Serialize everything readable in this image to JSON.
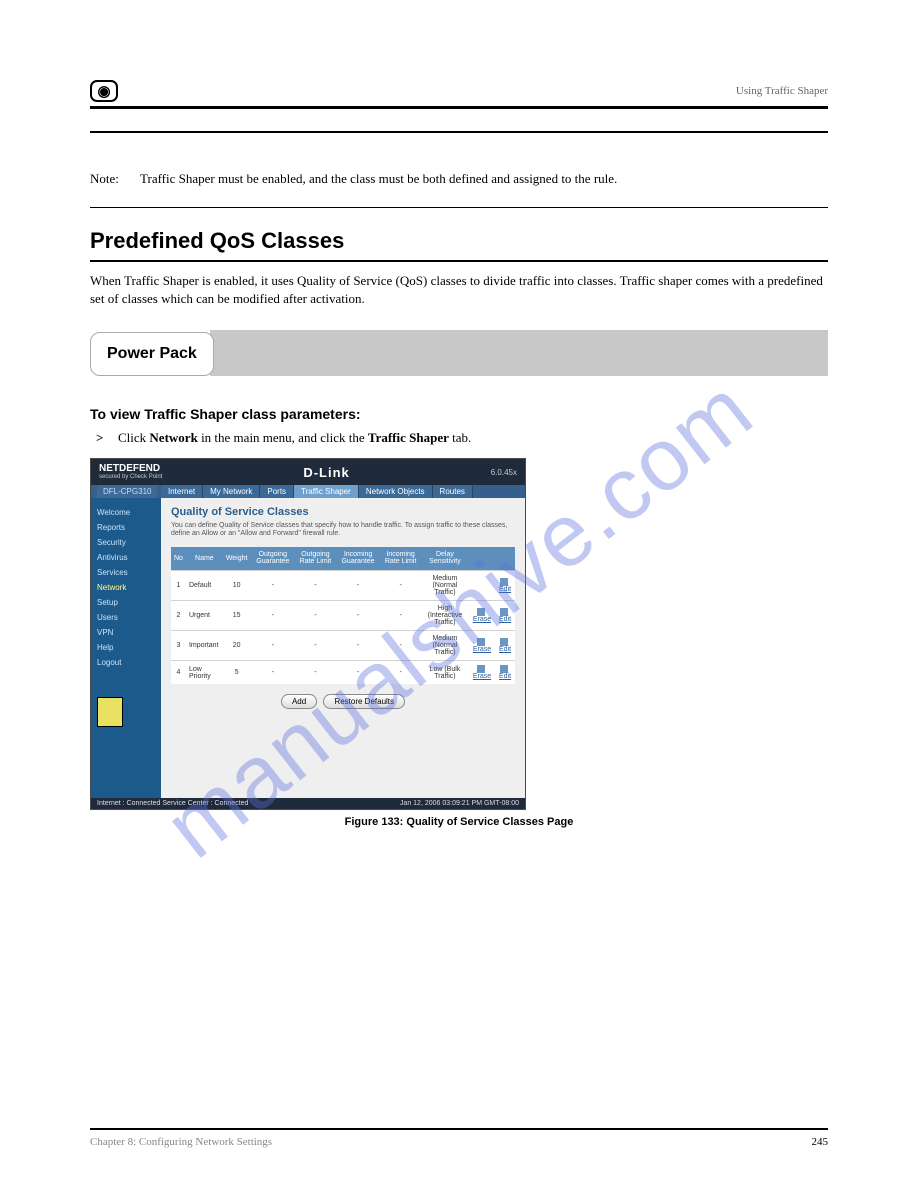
{
  "header": {
    "right_text": "Using Traffic Shaper"
  },
  "note": {
    "label": "Note:",
    "text": "Traffic Shaper must be enabled, and the class must be both defined and assigned to the rule."
  },
  "section": {
    "heading": "Predefined QoS Classes",
    "body": "When Traffic Shaper is enabled, it uses Quality of Service (QoS) classes to divide traffic into classes. Traffic shaper comes with a predefined set of classes which can be modified after activation."
  },
  "powerpack": {
    "label": "Power Pack"
  },
  "to_view": "To view Traffic Shaper class parameters:",
  "bullet": {
    "char": ">",
    "pre": "Click ",
    "b1": "Network",
    "mid": " in the main menu, and click the ",
    "b2": "Traffic Shaper",
    "post": " tab."
  },
  "screenshot": {
    "brand": "NETDEFEND",
    "brand_sub": "secured by Check Point",
    "logo": "D-Link",
    "version": "6.0.45x",
    "device": "DFL-CPG310",
    "tabs": [
      "Internet",
      "My Network",
      "Ports",
      "Traffic Shaper",
      "Network Objects",
      "Routes"
    ],
    "sidebar": [
      "Welcome",
      "Reports",
      "Security",
      "Antivirus",
      "Services",
      "Network",
      "Setup",
      "Users",
      "VPN",
      "Help",
      "Logout"
    ],
    "sidebar_active_index": 5,
    "main_heading": "Quality of Service Classes",
    "main_desc": "You can define Quality of Service classes that specify how to handle traffic. To assign traffic to these classes, define an Allow or an \"Allow and Forward\" firewall rule.",
    "headers": [
      "No",
      "Name",
      "Weight",
      "Outgoing Guarantee",
      "Outgoing Rate Limit",
      "Incoming Guarantee",
      "Incoming Rate Limit",
      "Delay Sensitivity"
    ],
    "rows": [
      {
        "no": "1",
        "name": "Default",
        "weight": "10",
        "og": "-",
        "orl": "-",
        "ig": "-",
        "irl": "-",
        "ds": "Medium (Normal Traffic)",
        "erase": false
      },
      {
        "no": "2",
        "name": "Urgent",
        "weight": "15",
        "og": "-",
        "orl": "-",
        "ig": "-",
        "irl": "-",
        "ds": "High (Interactive Traffic)",
        "erase": true
      },
      {
        "no": "3",
        "name": "Important",
        "weight": "20",
        "og": "-",
        "orl": "-",
        "ig": "-",
        "irl": "-",
        "ds": "Medium (Normal Traffic)",
        "erase": true
      },
      {
        "no": "4",
        "name": "Low Priority",
        "weight": "5",
        "og": "-",
        "orl": "-",
        "ig": "-",
        "irl": "-",
        "ds": "Low (Bulk Traffic)",
        "erase": true
      }
    ],
    "erase_label": "Erase",
    "edit_label": "Edit",
    "buttons": {
      "add": "Add",
      "restore": "Restore Defaults"
    },
    "status_left": "Internet : Connected Service Center : Connected",
    "status_right": "Jan 12, 2006 03:09:21 PM GMT-08:00",
    "caption": "Figure 133: Quality of Service Classes Page"
  },
  "footer": {
    "left": "Chapter 8: Configuring Network Settings",
    "right": "245"
  },
  "watermark": "manualshive.com"
}
